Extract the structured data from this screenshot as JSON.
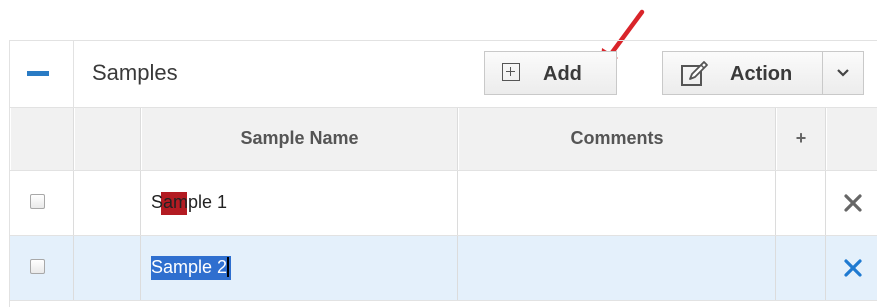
{
  "panel": {
    "title": "Samples",
    "collapse_icon": "minus-icon"
  },
  "toolbar": {
    "add_label": "Add",
    "add_icon": "plus-square-icon",
    "action_label": "Action",
    "action_icon": "edit-icon",
    "dropdown_icon": "chevron-down-icon"
  },
  "columns": {
    "sample_name": "Sample Name",
    "comments": "Comments",
    "add_column": "+"
  },
  "rows": [
    {
      "name": "Sample 1",
      "color": "#b31b22",
      "comment": "",
      "selected": false
    },
    {
      "name": "Sample 2",
      "color": "#2a4fa8",
      "comment": "",
      "selected": true
    }
  ],
  "colors": {
    "accent": "#2a7bc4",
    "selected_row": "#e4f0fb",
    "delete_default": "#666666",
    "delete_active": "#1f7ad1",
    "annotation_arrow": "#d9242a"
  }
}
